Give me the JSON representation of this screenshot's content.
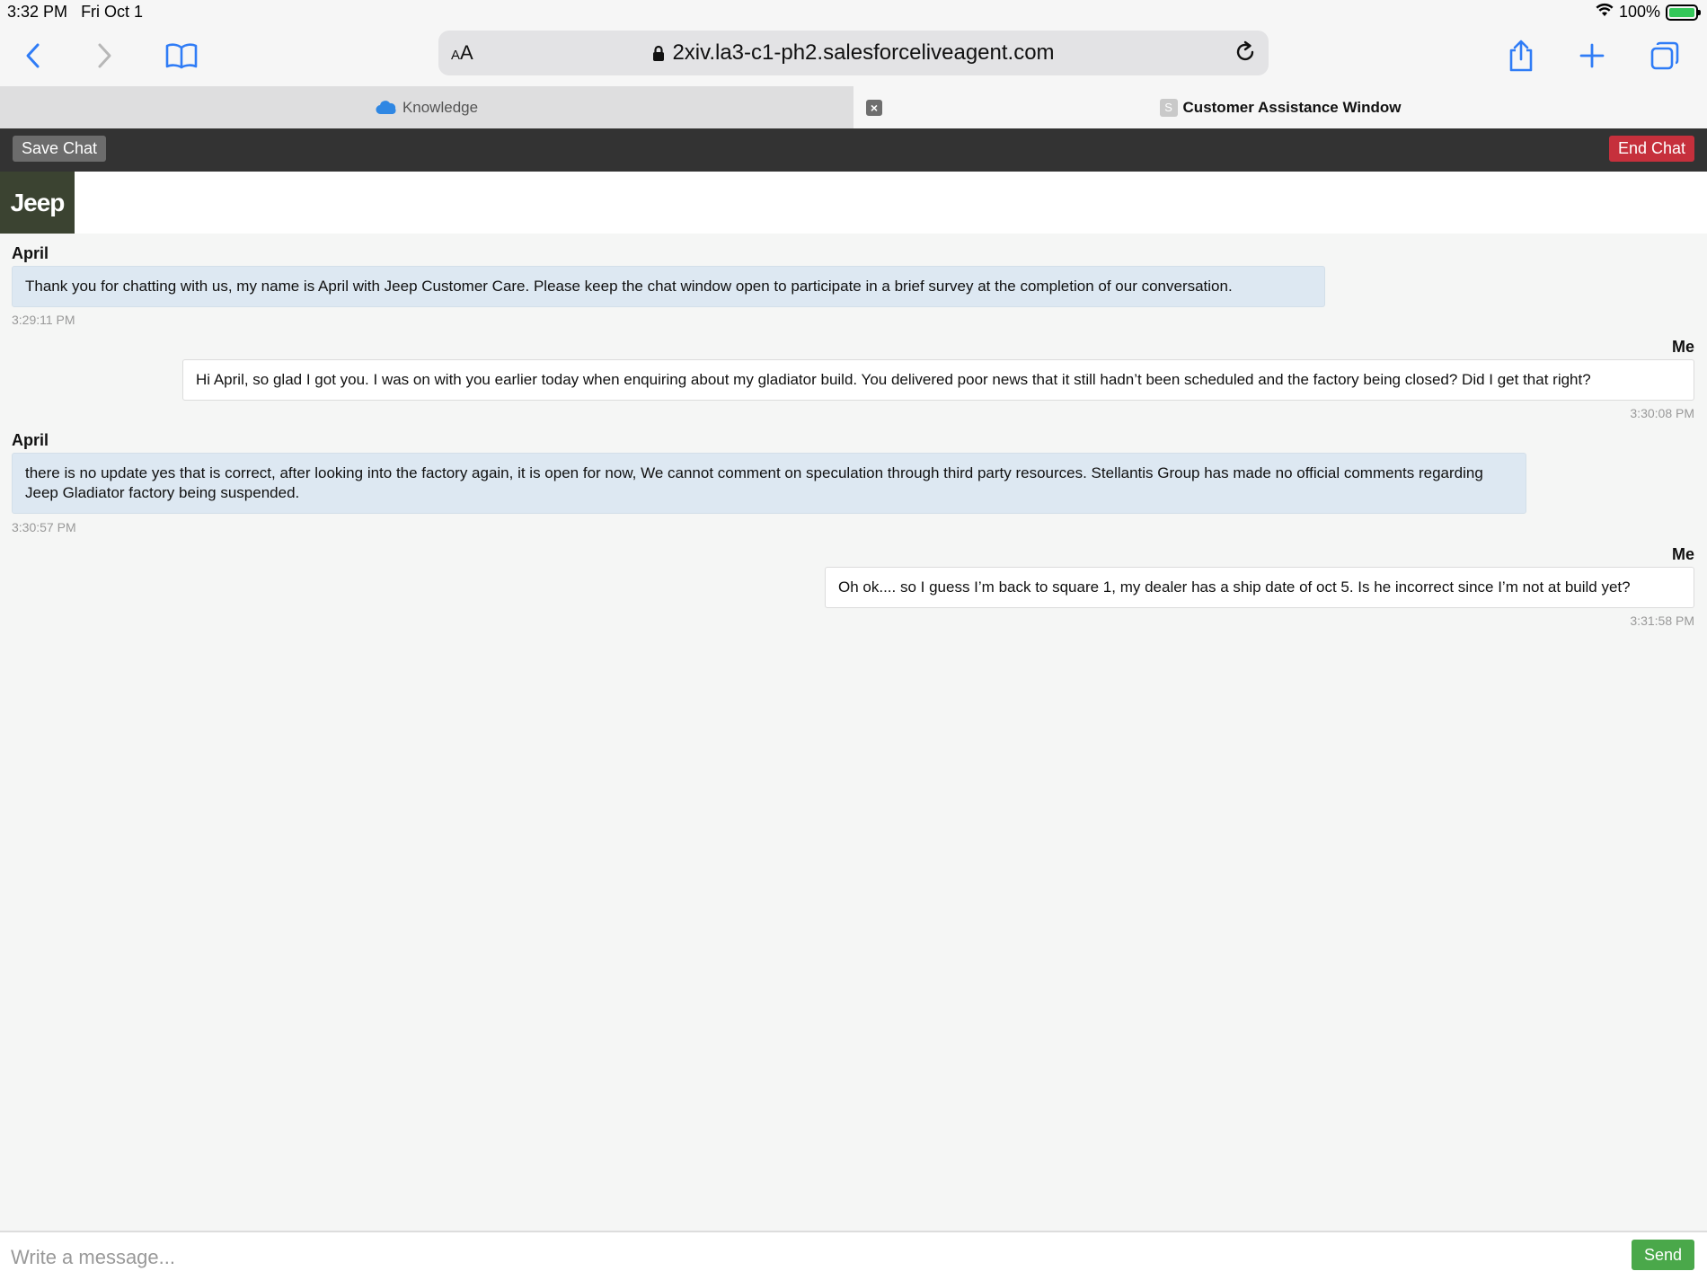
{
  "status_bar": {
    "time": "3:32 PM",
    "date": "Fri Oct 1",
    "battery": "100%"
  },
  "browser": {
    "reader_label": "AA",
    "url": "2xiv.la3-c1-ph2.salesforceliveagent.com",
    "tabs": [
      {
        "label": "Knowledge",
        "active": false
      },
      {
        "label": "Customer Assistance Window",
        "active": true,
        "favicon_letter": "S"
      }
    ]
  },
  "chat": {
    "save_label": "Save Chat",
    "end_label": "End Chat",
    "logo_text": "Jeep",
    "messages": [
      {
        "sender": "April",
        "text": "Thank you for chatting with us, my name is April with Jeep Customer Care. Please keep the chat window open to participate in a brief survey at the completion of our conversation.",
        "time": "3:29:11 PM"
      },
      {
        "sender": "Me",
        "text": "Hi April, so glad I got you. I was on with you earlier today when enquiring about my gladiator build. You delivered poor news that it still hadn’t been scheduled and the factory being closed? Did I get that right?",
        "time": "3:30:08 PM"
      },
      {
        "sender": "April",
        "text": "there is no update yes that is correct, after looking into the factory again, it is open for now, We cannot comment on speculation through third party resources. Stellantis Group has made no official comments regarding Jeep Gladiator factory being suspended.",
        "time": "3:30:57 PM"
      },
      {
        "sender": "Me",
        "text": "Oh ok.... so I guess I’m back to square 1, my dealer has a ship date of oct 5. Is he incorrect since I’m not at build yet?",
        "time": "3:31:58 PM"
      }
    ],
    "input_placeholder": "Write a message...",
    "send_label": "Send"
  }
}
